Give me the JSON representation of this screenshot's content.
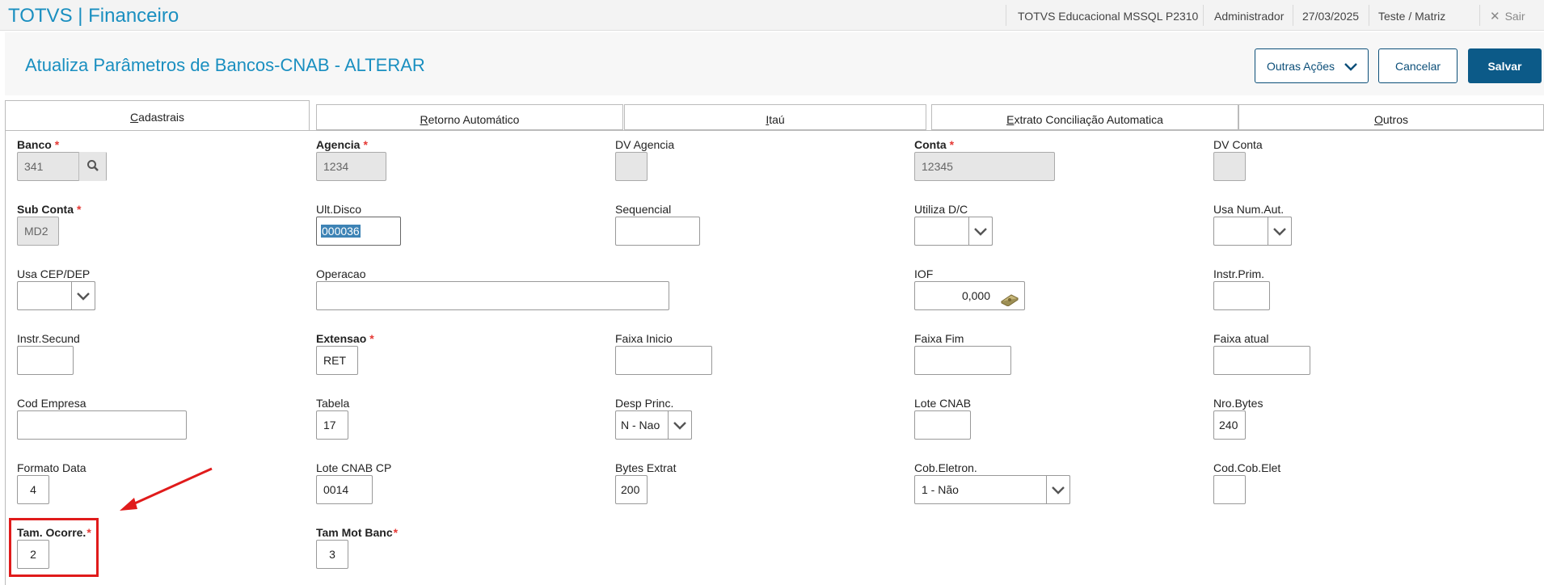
{
  "app": {
    "title": "TOTVS | Financeiro"
  },
  "topbar": {
    "environment": "TOTVS Educacional MSSQL P2310",
    "user": "Administrador",
    "date": "27/03/2025",
    "branch": "Teste / Matriz",
    "logout_label": "Sair"
  },
  "header": {
    "title": "Atualiza Parâmetros de Bancos-CNAB - ALTERAR",
    "buttons": {
      "more": "Outras Ações",
      "cancel": "Cancelar",
      "save": "Salvar"
    }
  },
  "tabs": [
    {
      "first": "C",
      "rest": "adastrais"
    },
    {
      "first": "R",
      "rest": "etorno Automático"
    },
    {
      "first": "I",
      "rest": "taú"
    },
    {
      "first": "E",
      "rest": "xtrato Conciliação Automatica"
    },
    {
      "first": "O",
      "rest": "utros"
    }
  ],
  "fields": {
    "banco": {
      "label": "Banco",
      "value": "341"
    },
    "agencia": {
      "label": "Agencia",
      "value": "1234"
    },
    "dv_agencia": {
      "label": "DV Agencia",
      "value": ""
    },
    "conta": {
      "label": "Conta",
      "value": "12345"
    },
    "dv_conta": {
      "label": "DV Conta",
      "value": ""
    },
    "sub_conta": {
      "label": "Sub Conta",
      "value": "MD2"
    },
    "ult_disco": {
      "label": "Ult.Disco",
      "value": "000036"
    },
    "sequencial": {
      "label": "Sequencial",
      "value": ""
    },
    "utiliza_dc": {
      "label": "Utiliza D/C",
      "value": ""
    },
    "usa_num_aut": {
      "label": "Usa Num.Aut.",
      "value": ""
    },
    "usa_cep_dep": {
      "label": "Usa CEP/DEP",
      "value": ""
    },
    "operacao": {
      "label": "Operacao",
      "value": ""
    },
    "iof": {
      "label": "IOF",
      "value": "0,000"
    },
    "instr_prim": {
      "label": "Instr.Prim.",
      "value": ""
    },
    "instr_secund": {
      "label": "Instr.Secund",
      "value": ""
    },
    "extensao": {
      "label": "Extensao",
      "value": "RET"
    },
    "faixa_inicio": {
      "label": "Faixa Inicio",
      "value": ""
    },
    "faixa_fim": {
      "label": "Faixa Fim",
      "value": ""
    },
    "faixa_atual": {
      "label": "Faixa atual",
      "value": ""
    },
    "cod_empresa": {
      "label": "Cod Empresa",
      "value": ""
    },
    "tabela": {
      "label": "Tabela",
      "value": "17"
    },
    "desp_princ": {
      "label": "Desp Princ.",
      "value": "N - Nao"
    },
    "lote_cnab": {
      "label": "Lote CNAB",
      "value": ""
    },
    "nro_bytes": {
      "label": "Nro.Bytes",
      "value": "240"
    },
    "formato_data": {
      "label": "Formato Data",
      "value": "4"
    },
    "lote_cnab_cp": {
      "label": "Lote CNAB CP",
      "value": "0014"
    },
    "bytes_extrat": {
      "label": "Bytes Extrat",
      "value": "200"
    },
    "cob_eletron": {
      "label": "Cob.Eletron.",
      "value": "1 - Não"
    },
    "cod_cob_elet": {
      "label": "Cod.Cob.Elet",
      "value": ""
    },
    "tam_ocorre": {
      "label": "Tam. Ocorre.",
      "value": "2"
    },
    "tam_mot_banc": {
      "label": "Tam Mot Banc",
      "value": "3"
    }
  },
  "required_marker": "*",
  "colors": {
    "brand": "#1a8fc0",
    "primary_button": "#0c5a88",
    "required": "#e53935",
    "annotation": "#e01b1b"
  }
}
